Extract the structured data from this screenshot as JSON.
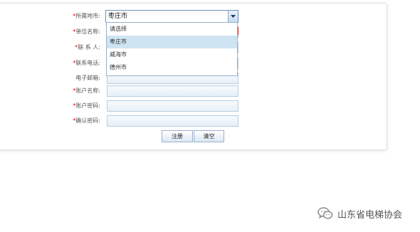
{
  "form": {
    "region_label": "所属地市:",
    "unit_label": "单位名称:",
    "contact_label": "联 系 人:",
    "phone_label": "联系电话:",
    "email_label": "电子邮箱:",
    "account_label": "账户名称:",
    "password_label": "账户密码:",
    "confirm_label": "确认密码:",
    "required_mark": "*"
  },
  "select": {
    "value": "枣庄市",
    "options": [
      "请选择",
      "枣庄市",
      "威海市",
      "德州市"
    ],
    "selected_index": 1
  },
  "buttons": {
    "register": "注册",
    "clear": "清空"
  },
  "watermark": {
    "text": "山东省电梯协会"
  },
  "colors": {
    "accent_border": "#6f8fb4",
    "selected_option": "#cfe4f3",
    "required": "#dd0000"
  }
}
